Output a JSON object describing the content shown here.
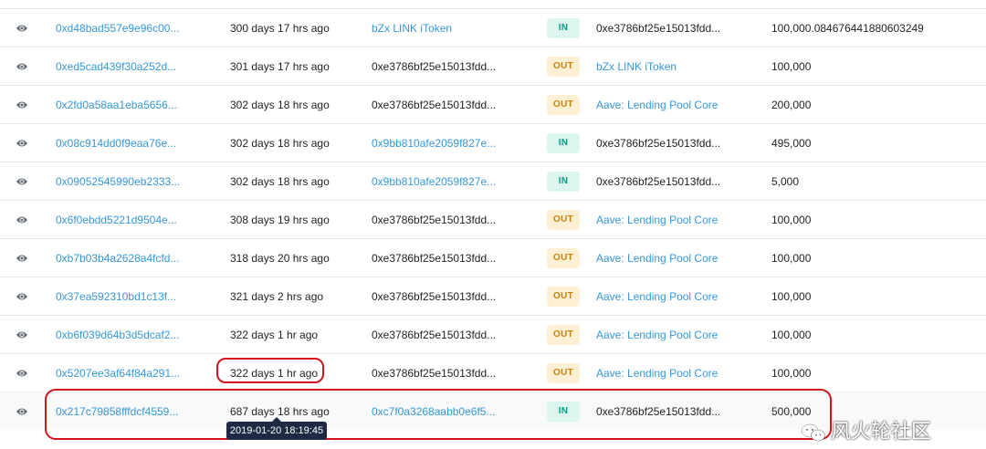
{
  "rows": [
    {
      "hash": "0xd48bad557e9e96c00...",
      "age": "300 days 17 hrs ago",
      "from": "bZx LINK iToken",
      "from_link": true,
      "direction": "IN",
      "to": "0xe3786bf25e15013fdd...",
      "to_link": false,
      "value": "100,000.084676441880603249"
    },
    {
      "hash": "0xed5cad439f30a252d...",
      "age": "301 days 17 hrs ago",
      "from": "0xe3786bf25e15013fdd...",
      "from_link": false,
      "direction": "OUT",
      "to": "bZx LINK iToken",
      "to_link": true,
      "value": "100,000"
    },
    {
      "hash": "0x2fd0a58aa1eba5656...",
      "age": "302 days 18 hrs ago",
      "from": "0xe3786bf25e15013fdd...",
      "from_link": false,
      "direction": "OUT",
      "to": "Aave: Lending Pool Core",
      "to_link": true,
      "value": "200,000"
    },
    {
      "hash": "0x08c914dd0f9eaa76e...",
      "age": "302 days 18 hrs ago",
      "from": "0x9bb810afe2059f827e...",
      "from_link": true,
      "direction": "IN",
      "to": "0xe3786bf25e15013fdd...",
      "to_link": false,
      "value": "495,000"
    },
    {
      "hash": "0x09052545990eb2333...",
      "age": "302 days 18 hrs ago",
      "from": "0x9bb810afe2059f827e...",
      "from_link": true,
      "direction": "IN",
      "to": "0xe3786bf25e15013fdd...",
      "to_link": false,
      "value": "5,000"
    },
    {
      "hash": "0x6f0ebdd5221d9504e...",
      "age": "308 days 19 hrs ago",
      "from": "0xe3786bf25e15013fdd...",
      "from_link": false,
      "direction": "OUT",
      "to": "Aave: Lending Pool Core",
      "to_link": true,
      "value": "100,000"
    },
    {
      "hash": "0xb7b03b4a2628a4fcfd...",
      "age": "318 days 20 hrs ago",
      "from": "0xe3786bf25e15013fdd...",
      "from_link": false,
      "direction": "OUT",
      "to": "Aave: Lending Pool Core",
      "to_link": true,
      "value": "100,000"
    },
    {
      "hash": "0x37ea592310bd1c13f...",
      "age": "321 days 2 hrs ago",
      "from": "0xe3786bf25e15013fdd...",
      "from_link": false,
      "direction": "OUT",
      "to": "Aave: Lending Pool Core",
      "to_link": true,
      "value": "100,000"
    },
    {
      "hash": "0xb6f039d64b3d5dcaf2...",
      "age": "322 days 1 hr ago",
      "from": "0xe3786bf25e15013fdd...",
      "from_link": false,
      "direction": "OUT",
      "to": "Aave: Lending Pool Core",
      "to_link": true,
      "value": "100,000"
    },
    {
      "hash": "0x5207ee3af64f84a291...",
      "age": "322 days 1 hr ago",
      "from": "0xe3786bf25e15013fdd...",
      "from_link": false,
      "direction": "OUT",
      "to": "Aave: Lending Pool Core",
      "to_link": true,
      "value": "100,000"
    },
    {
      "hash": "0x217c79858fffdcf4559...",
      "age": "687 days 18 hrs ago",
      "from": "0xc7f0a3268aabb0e6f5...",
      "from_link": true,
      "direction": "IN",
      "to": "0xe3786bf25e15013fdd...",
      "to_link": false,
      "value": "500,000"
    }
  ],
  "tooltip": "2019-01-20 18:19:45",
  "watermark": "风火轮社区",
  "colors": {
    "link": "#3498db",
    "in_bg": "#dcf5ee",
    "in_text": "#00a186",
    "out_bg": "#fdf0d5",
    "out_text": "#c9830c",
    "annotation": "#d4131c"
  },
  "icons": {
    "row_action": "eye-icon",
    "watermark": "wechat-logo-icon"
  }
}
